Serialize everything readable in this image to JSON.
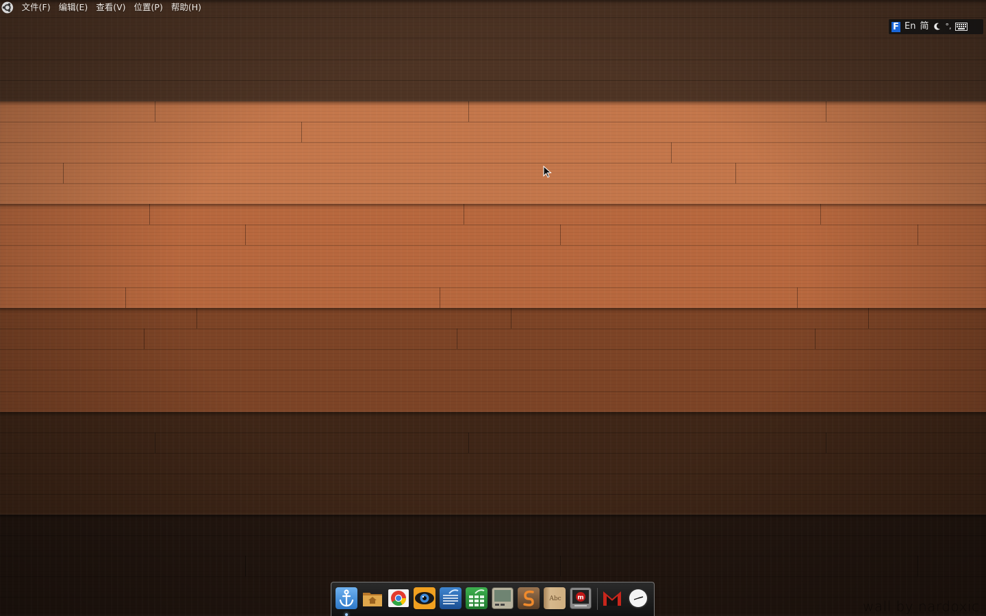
{
  "menubar": {
    "logo_icon": "ubuntu-logo-icon",
    "items": [
      {
        "label": "文件(F)"
      },
      {
        "label": "编辑(E)"
      },
      {
        "label": "查看(V)"
      },
      {
        "label": "位置(P)"
      },
      {
        "label": "帮助(H)"
      }
    ]
  },
  "tray": {
    "ime_icon": "fcitx-icon",
    "ime_letter": "F",
    "lang": "En",
    "script": "简",
    "moon_icon": "half-width-moon-icon",
    "punct": "°,",
    "keyboard_icon": "keyboard-icon"
  },
  "dock": {
    "items": [
      {
        "icon": "anchor-icon",
        "name": "docky-anchor",
        "color": "#3d8fe0"
      },
      {
        "icon": "home-folder-icon",
        "name": "home-folder",
        "color": "#d79a3a"
      },
      {
        "icon": "chrome-icon",
        "name": "google-chrome",
        "color": "#2e7bd6"
      },
      {
        "icon": "eye-icon",
        "name": "eye-app",
        "color": "#e08a1e"
      },
      {
        "icon": "writer-icon",
        "name": "libreoffice-writer",
        "color": "#2b6fb6"
      },
      {
        "icon": "calc-icon",
        "name": "libreoffice-calc",
        "color": "#2f9a3c"
      },
      {
        "icon": "terminal-icon",
        "name": "terminal-screen",
        "color": "#6a7a6a"
      },
      {
        "icon": "sublime-icon",
        "name": "sublime-text",
        "color": "#7a5a3a"
      },
      {
        "icon": "dictionary-icon",
        "name": "dictionary",
        "color": "#c2a27a"
      },
      {
        "icon": "miro-icon",
        "name": "miro-player",
        "color": "#b02020"
      },
      {
        "icon": "gmail-icon",
        "name": "gmail",
        "color": "#cc2a1f"
      },
      {
        "icon": "clock-icon",
        "name": "clock",
        "color": "#eeeeee"
      }
    ]
  },
  "wallpaper": {
    "credit": "wall by nardoxic",
    "colors": [
      "#4e3424",
      "#c8784a",
      "#b9683e",
      "#7e4426",
      "#3f2617",
      "#241710"
    ]
  }
}
